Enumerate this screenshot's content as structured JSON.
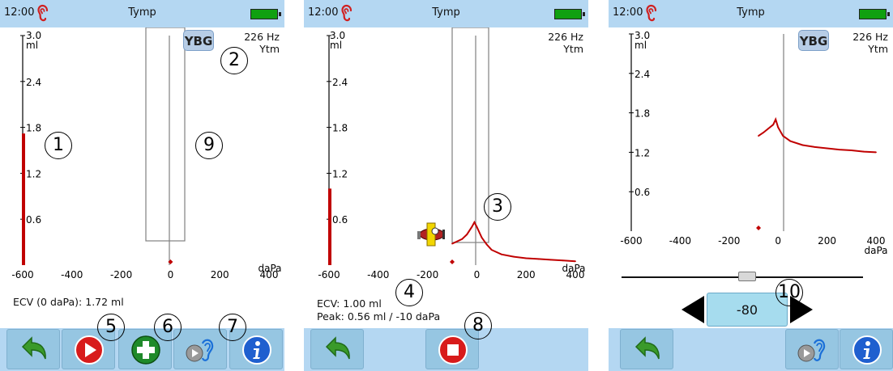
{
  "status": {
    "time": "12:00",
    "title": "Tymp"
  },
  "graph": {
    "y_top_label": "3.0",
    "y_unit": "ml",
    "y_ticks": [
      "2.4",
      "1.8",
      "1.2",
      "0.6"
    ],
    "x_ticks": [
      "-600",
      "-400",
      "-200",
      "0",
      "200",
      "400"
    ],
    "x_unit": "daPa"
  },
  "freq": {
    "hz": "226 Hz",
    "mode": "Ytm"
  },
  "ybg_label": "YBG",
  "screen1": {
    "ecv": "ECV (0 daPa): 1.72 ml",
    "compliance_bar_ml": 1.72
  },
  "screen2": {
    "ecv": "ECV: 1.00 ml",
    "peak": "Peak: 0.56 ml / -10 daPa",
    "compliance_bar_ml": 1.0
  },
  "screen3": {
    "pressure_value": "-80"
  },
  "markers": [
    "1",
    "2",
    "3",
    "4",
    "5",
    "6",
    "7",
    "8",
    "9",
    "10"
  ],
  "icons": {
    "back": "back-arrow-icon",
    "play": "play-icon",
    "add": "add-icon",
    "ear": "ear-play-icon",
    "info": "info-icon",
    "stop": "stop-icon"
  },
  "colors": {
    "statusbar": "#b4d7f2",
    "curve": "#c00000",
    "button": "#96c6e2"
  },
  "chart_data": [
    {
      "type": "line",
      "series": [],
      "xlim": [
        -600,
        400
      ],
      "ylim": [
        0,
        3.0
      ],
      "xlabel": "daPa",
      "ylabel": "ml"
    },
    {
      "type": "line",
      "series": [
        {
          "x": [
            -100,
            -60,
            -40,
            -20,
            -10,
            0,
            20,
            40,
            60,
            80,
            100,
            150,
            200,
            250,
            300,
            350,
            400
          ],
          "y": [
            0.28,
            0.34,
            0.4,
            0.5,
            0.56,
            0.5,
            0.36,
            0.27,
            0.2,
            0.17,
            0.14,
            0.11,
            0.09,
            0.08,
            0.07,
            0.06,
            0.05
          ]
        }
      ],
      "xlim": [
        -600,
        400
      ],
      "ylim": [
        0,
        3.0
      ],
      "xlabel": "daPa",
      "ylabel": "ml"
    },
    {
      "type": "line",
      "series": [
        {
          "x": [
            -80,
            -60,
            -40,
            -20,
            -10,
            0,
            20,
            50,
            100,
            150,
            200,
            250,
            300,
            350,
            400
          ],
          "y": [
            1.45,
            1.5,
            1.56,
            1.62,
            1.7,
            1.58,
            1.45,
            1.37,
            1.31,
            1.28,
            1.26,
            1.24,
            1.23,
            1.21,
            1.2
          ]
        }
      ],
      "xlim": [
        -600,
        400
      ],
      "ylim": [
        0,
        3.0
      ],
      "xlabel": "daPa",
      "ylabel": "ml"
    }
  ]
}
